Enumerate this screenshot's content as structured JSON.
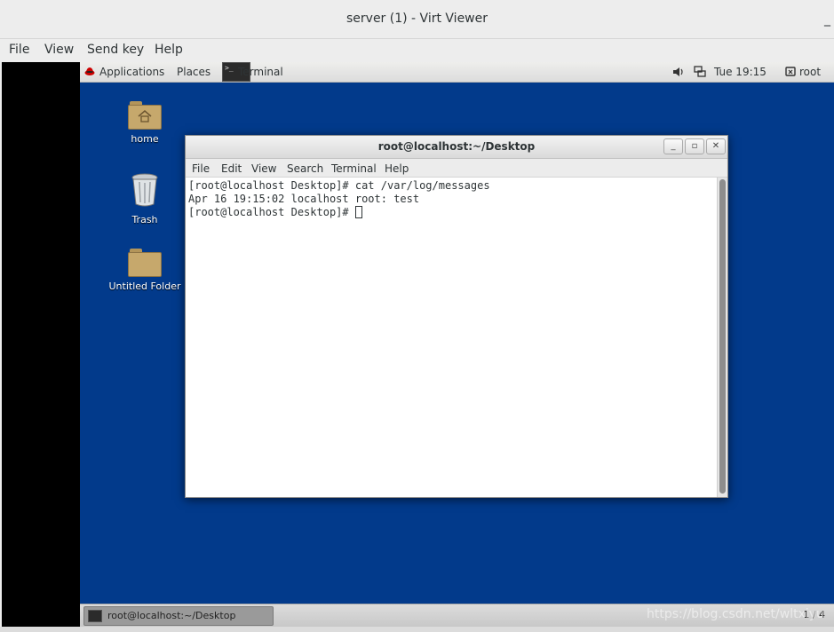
{
  "window": {
    "title": "server (1) - Virt Viewer",
    "minimize": "_"
  },
  "outer_menu": [
    "File",
    "View",
    "Send key",
    "Help"
  ],
  "topbar": {
    "applications": "Applications",
    "places": "Places",
    "task": "Terminal",
    "clock": "Tue 19:15",
    "user": "root"
  },
  "desktop": {
    "icons": [
      {
        "label": "home"
      },
      {
        "label": "Trash"
      },
      {
        "label": "Untitled Folder"
      }
    ]
  },
  "terminal": {
    "title": "root@localhost:~/Desktop",
    "menu": [
      "File",
      "Edit",
      "View",
      "Search",
      "Terminal",
      "Help"
    ],
    "lines": [
      "[root@localhost Desktop]# cat /var/log/messages",
      "Apr 16 19:15:02 localhost root: test",
      "[root@localhost Desktop]# "
    ]
  },
  "taskbar": {
    "item": "root@localhost:~/Desktop",
    "pager": "1 / 4"
  },
  "watermark": "https://blog.csdn.net/wltxiyu"
}
